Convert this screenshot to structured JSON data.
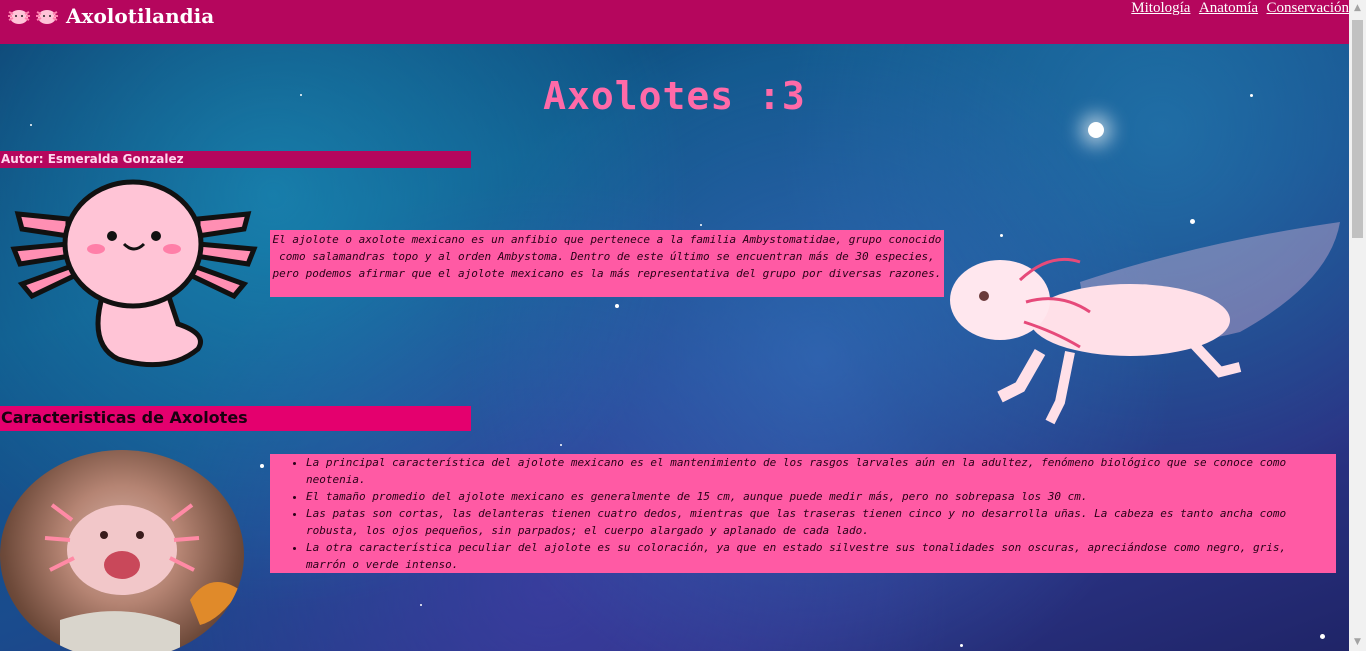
{
  "header": {
    "title": "Axolotilandia",
    "nav": [
      "Mitología",
      "Anatomía",
      "Conservación"
    ]
  },
  "page": {
    "heading": "Axolotes :3",
    "author": "Autor: Esmeralda Gonzalez",
    "intro": "El ajolote o axolote mexicano es un anfibio que pertenece a la familia Ambystomatidae, grupo conocido como salamandras topo y al orden Ambystoma. Dentro de este último se encuentran más de 30 especies, pero podemos afirmar que el ajolote mexicano es la más representativa del grupo por diversas razones.",
    "section_title": "Caracteristicas de Axolotes",
    "characteristics": [
      "La principal característica del ajolote mexicano es el mantenimiento de los rasgos larvales aún en la adultez, fenómeno biológico que se conoce como neotenia.",
      "El tamaño promedio del ajolote mexicano es generalmente de 15 cm, aunque puede medir más, pero no sobrepasa los 30 cm.",
      "Las patas son cortas, las delanteras tienen cuatro dedos, mientras que las traseras tienen cinco y no desarrolla uñas. La cabeza es tanto ancha como robusta, los ojos pequeños, sin parpados; el cuerpo alargado y aplanado de cada lado.",
      "La otra característica peculiar del ajolote es su coloración, ya que en estado silvestre sus tonalidades son oscuras, apreciándose como negro, gris, marrón o verde intenso."
    ]
  },
  "colors": {
    "header_bg": "#b5065d",
    "title_pink": "#ff6aa8",
    "box_pink": "#ff5aa4",
    "section_bar": "#e4006e"
  },
  "icons": [
    "axolotl-logo-icon"
  ]
}
